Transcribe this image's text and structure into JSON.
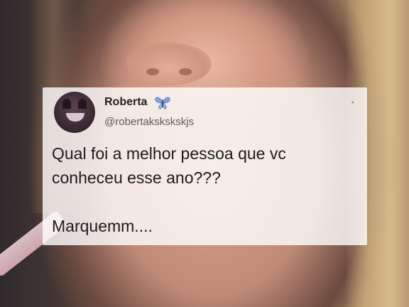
{
  "tweet": {
    "display_name": "Roberta",
    "name_emoji_icon": "butterfly-icon",
    "handle": "@robertakskskskjs",
    "text": "Qual foi a melhor pessoa que vc\nconheceu esse ano???\n\nMarquemm....",
    "more_icon": "more-options-icon"
  },
  "colors": {
    "card_background": "#ffffff",
    "butterfly": "#7fa6e0"
  }
}
